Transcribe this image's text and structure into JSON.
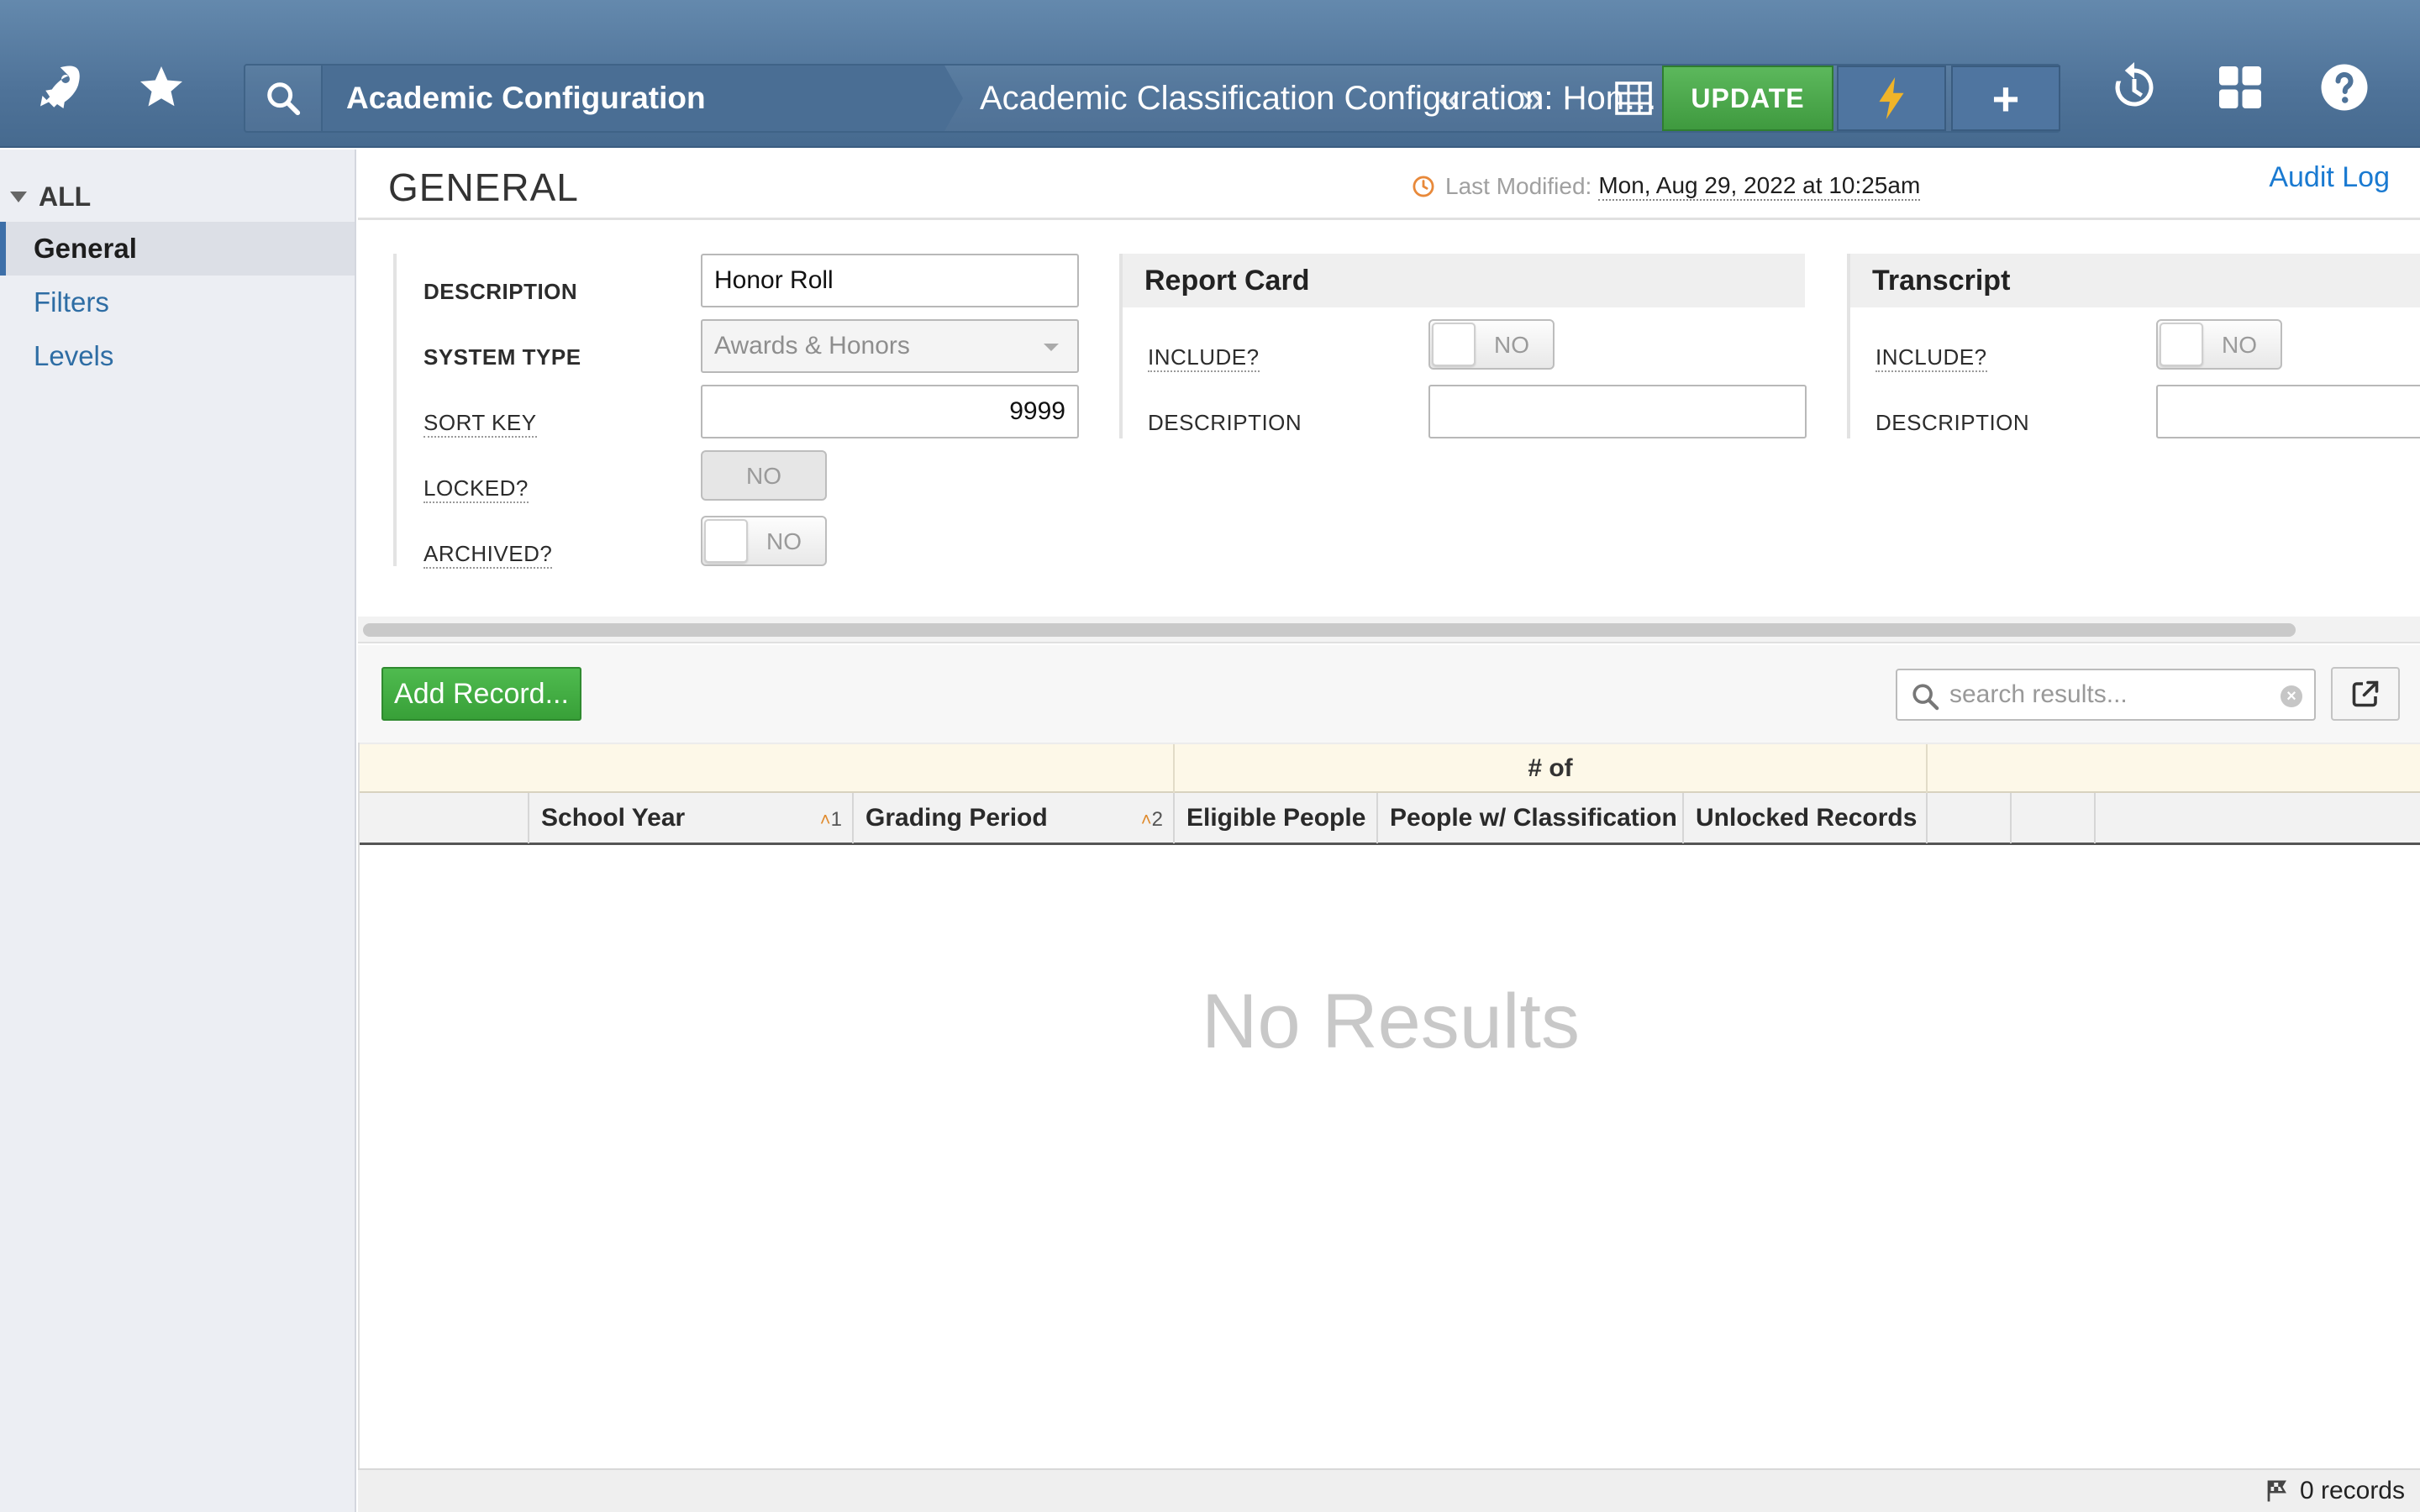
{
  "topbar": {
    "breadcrumb_root": "Academic Configuration",
    "breadcrumb_current": "Academic Classification Configuration: Hon…",
    "prev_glyph": "«",
    "next_glyph": "»",
    "update_label": "UPDATE",
    "plus_glyph": "+",
    "icons": [
      "rocket-icon",
      "star-icon",
      "search-icon",
      "table-icon",
      "bolt-icon",
      "plus-icon",
      "history-icon",
      "apps-grid-icon",
      "help-icon"
    ]
  },
  "sidebar": {
    "all_label": "ALL",
    "items": [
      {
        "label": "General",
        "active": true
      },
      {
        "label": "Filters",
        "active": false
      },
      {
        "label": "Levels",
        "active": false
      }
    ]
  },
  "header": {
    "title": "GENERAL",
    "last_modified_label": "Last Modified:",
    "last_modified_value": "Mon, Aug 29, 2022 at 10:25am",
    "audit_log": "Audit Log"
  },
  "general": {
    "description_label": "DESCRIPTION",
    "description_value": "Honor Roll",
    "system_type_label": "SYSTEM TYPE",
    "system_type_value": "Awards & Honors",
    "sort_key_label": "SORT KEY",
    "sort_key_value": "9999",
    "locked_label": "LOCKED?",
    "locked_value": "NO",
    "archived_label": "ARCHIVED?",
    "archived_value": "NO"
  },
  "report_card": {
    "title": "Report Card",
    "include_label": "INCLUDE?",
    "include_value": "NO",
    "description_label": "DESCRIPTION",
    "description_value": ""
  },
  "transcript": {
    "title": "Transcript",
    "include_label": "INCLUDE?",
    "include_value": "NO",
    "description_label": "DESCRIPTION",
    "description_value": ""
  },
  "grid": {
    "add_record_label": "Add Record...",
    "search_placeholder": "search results...",
    "group_header": "# of",
    "columns": [
      {
        "label": "School Year",
        "sort": "1"
      },
      {
        "label": "Grading Period",
        "sort": "2"
      },
      {
        "label": "Eligible People"
      },
      {
        "label": "People w/ Classification"
      },
      {
        "label": "Unlocked Records"
      }
    ],
    "empty_text": "No Results",
    "record_count": "0 records"
  },
  "colors": {
    "topbar": "#5679a0",
    "update_green": "#4cae4c",
    "link_blue": "#1a7ad1",
    "sort_orange": "#e08a2c"
  }
}
